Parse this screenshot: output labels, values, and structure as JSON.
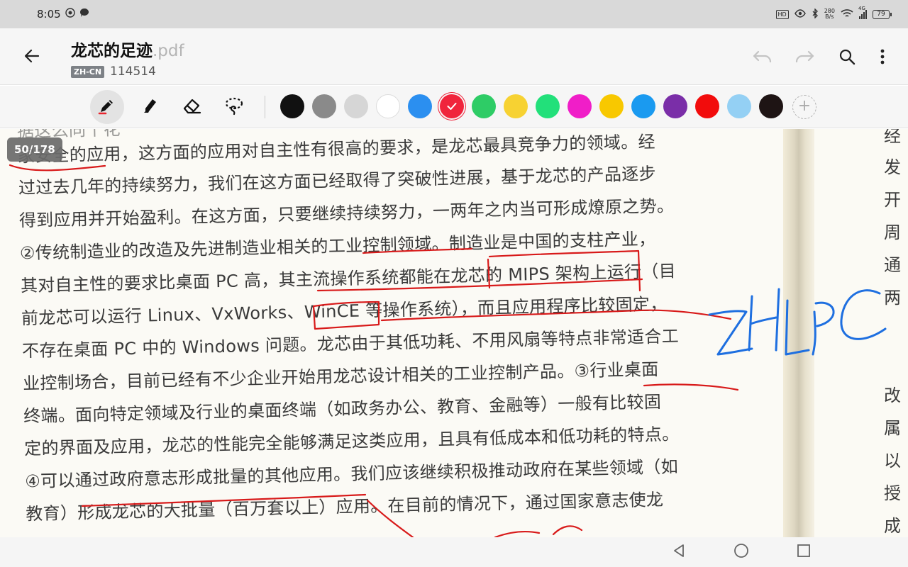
{
  "status_bar": {
    "time": "8:05",
    "hd_label": "HD",
    "speed_value": "280",
    "speed_unit": "B/s",
    "signal_label": "4G",
    "battery_level": "79"
  },
  "header": {
    "title": "龙芯的足迹",
    "extension": ".pdf",
    "language_badge": "ZH-CN",
    "doc_id": "114514"
  },
  "toolbar": {
    "tools": [
      "pen",
      "highlighter",
      "eraser",
      "lasso"
    ],
    "active_tool": "pen",
    "colors": [
      "#111111",
      "#8a8a8a",
      "#d6d6d6",
      "#ffffff",
      "#2b8ff0",
      "#f0243c",
      "#2ecc66",
      "#f7d232",
      "#22e07a",
      "#f01ec8",
      "#f8c800",
      "#1a9af0",
      "#7a2ea8",
      "#f20c0c",
      "#94d0f4",
      "#1e1414"
    ],
    "selected_color_index": 5
  },
  "document": {
    "page_indicator": "50/178",
    "lines": [
      "据这么同个花",
      "家安全的应用，这方面的应用对自主性有很高的要求，是龙芯最具竞争力的领域。经",
      "过过去几年的持续努力，我们在这方面已经取得了突破性进展，基于龙芯的产品逐步",
      "得到应用并开始盈利。在这方面，只要继续持续努力，一两年之内当可形成燎原之势。",
      "②传统制造业的改造及先进制造业相关的工业控制领域。制造业是中国的支柱产业，",
      "其对自主性的要求比桌面 PC 高，其主流操作系统都能在龙芯的 MIPS 架构上运行（目",
      "前龙芯可以运行 Linux、VxWorks、WinCE 等操作系统），而且应用程序比较固定，",
      "不存在桌面 PC 中的 Windows 问题。龙芯由于其低功耗、不用风扇等特点非常适合工",
      "业控制场合，目前已经有不少企业开始用龙芯设计相关的工业控制产品。③行业桌面",
      "终端。面向特定领域及行业的桌面终端（如政务办公、教育、金融等）一般有比较固",
      "定的界面及应用，龙芯的性能完全能够满足这类应用，且具有低成本和低功耗的特点。",
      "④可以通过政府意志形成批量的其他应用。我们应该继续积极推动政府在某些领域（如",
      "教育）形成龙芯的大批量（百万套以上）应用。在目前的情况下，通过国家意志使龙"
    ],
    "right_column_chars": [
      "经",
      "发",
      "开",
      "周",
      "通",
      "两",
      "改",
      "属",
      "以",
      "授",
      "成"
    ],
    "handwritten_note": "ZHIPC"
  },
  "icons": {
    "back": "arrow-left-icon",
    "undo": "undo-icon",
    "redo": "redo-icon",
    "search": "search-icon",
    "more": "more-vertical-icon"
  }
}
